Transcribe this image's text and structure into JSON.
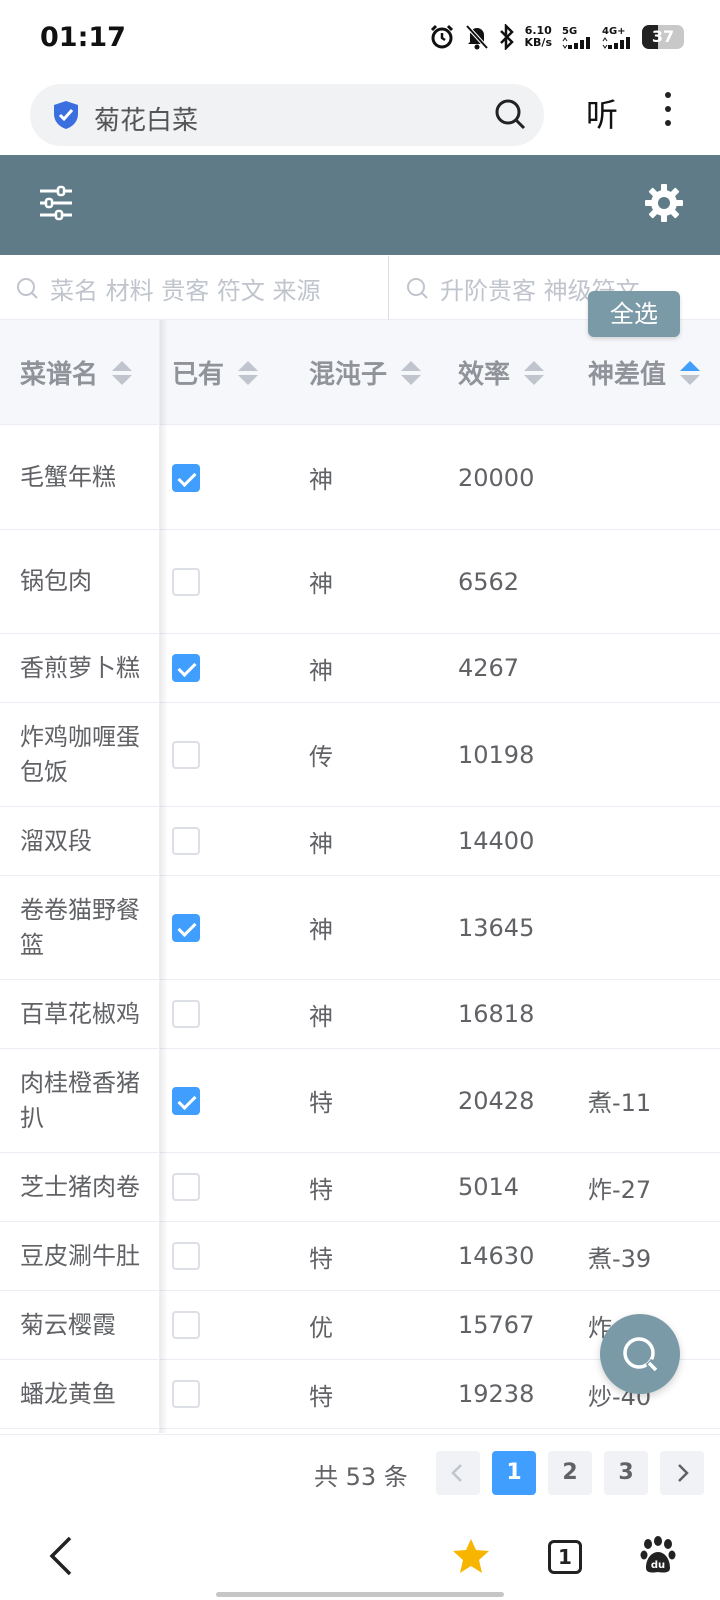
{
  "status_bar": {
    "time": "01:17",
    "net_speed_value": "6.10",
    "net_speed_unit": "KB/s",
    "signal_1": "5G",
    "signal_2": "4G+",
    "battery": "37",
    "battery_level": 0.37
  },
  "browser": {
    "search_text": "菊花白菜",
    "listen_label": "听"
  },
  "filters": {
    "recipe_placeholder": "菜名 材料 贵客 符文 来源",
    "upgrade_placeholder": "升阶贵客 神级符文",
    "select_all_label": "全选"
  },
  "table": {
    "headers": {
      "name": "菜谱名",
      "owned": "已有",
      "chaos": "混沌子",
      "efficiency": "效率",
      "diff": "神差值"
    },
    "rows": [
      {
        "name": "毛蟹年糕",
        "owned": true,
        "rank": "神",
        "efficiency": "20000",
        "diff": ""
      },
      {
        "name": "锅包肉",
        "owned": false,
        "rank": "神",
        "efficiency": "6562",
        "diff": ""
      },
      {
        "name": "香煎萝卜糕",
        "owned": true,
        "rank": "神",
        "efficiency": "4267",
        "diff": ""
      },
      {
        "name": "炸鸡咖喱蛋包饭",
        "owned": false,
        "rank": "传",
        "efficiency": "10198",
        "diff": ""
      },
      {
        "name": "溜双段",
        "owned": false,
        "rank": "神",
        "efficiency": "14400",
        "diff": ""
      },
      {
        "name": "卷卷猫野餐篮",
        "owned": true,
        "rank": "神",
        "efficiency": "13645",
        "diff": ""
      },
      {
        "name": "百草花椒鸡",
        "owned": false,
        "rank": "神",
        "efficiency": "16818",
        "diff": ""
      },
      {
        "name": "肉桂橙香猪扒",
        "owned": true,
        "rank": "特",
        "efficiency": "20428",
        "diff": "煮-11"
      },
      {
        "name": "芝士猪肉卷",
        "owned": false,
        "rank": "特",
        "efficiency": "5014",
        "diff": "炸-27"
      },
      {
        "name": "豆皮涮牛肚",
        "owned": false,
        "rank": "特",
        "efficiency": "14630",
        "diff": "煮-39"
      },
      {
        "name": "菊云樱霞",
        "owned": false,
        "rank": "优",
        "efficiency": "15767",
        "diff": "炸"
      },
      {
        "name": "蟠龙黄鱼",
        "owned": false,
        "rank": "特",
        "efficiency": "19238",
        "diff": "炒-40"
      }
    ]
  },
  "pagination": {
    "total": "共 53 条",
    "pages": [
      "1",
      "2",
      "3"
    ],
    "current": "1"
  },
  "bottom_nav": {
    "tab_count": "1"
  },
  "colors": {
    "header_bg": "#5f7b88",
    "accent": "#409eff",
    "fab_bg": "#7b9aa7"
  }
}
